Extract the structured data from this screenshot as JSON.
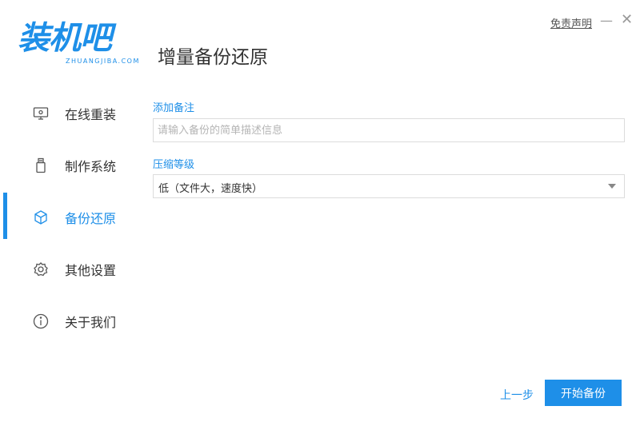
{
  "logo": {
    "main": "装机吧",
    "sub": "ZHUANGJIBA.COM"
  },
  "page_title": "增量备份还原",
  "window": {
    "disclaimer": "免责声明",
    "minimize": "—",
    "close": "✕"
  },
  "sidebar": {
    "items": [
      {
        "label": "在线重装",
        "icon": "monitor-icon",
        "active": false
      },
      {
        "label": "制作系统",
        "icon": "usb-icon",
        "active": false
      },
      {
        "label": "备份还原",
        "icon": "backup-cube-icon",
        "active": true
      },
      {
        "label": "其他设置",
        "icon": "gear-icon",
        "active": false
      },
      {
        "label": "关于我们",
        "icon": "info-icon",
        "active": false
      }
    ]
  },
  "form": {
    "note_label": "添加备注",
    "note_placeholder": "请输入备份的简单描述信息",
    "compress_label": "压缩等级",
    "compress_value": "低（文件大，速度快）"
  },
  "footer": {
    "prev": "上一步",
    "start": "开始备份"
  },
  "colors": {
    "accent": "#1e8fe8"
  }
}
